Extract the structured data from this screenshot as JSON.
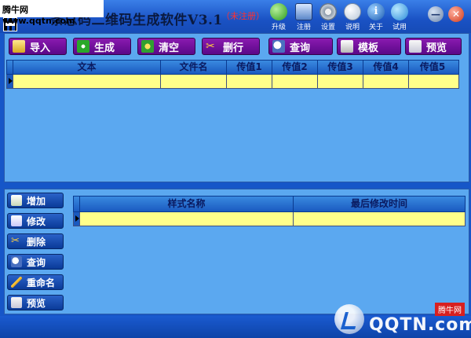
{
  "watermark": {
    "top_left": "腾牛网 www.qqtn.com",
    "brand": "QQTN.com",
    "brand_small": "腾牛网"
  },
  "app": {
    "title": "条总码二维码生成软件V3.1",
    "register_status": "（未注册）"
  },
  "title_toolbar": [
    {
      "label": "升级",
      "icon": "upgrade-icon"
    },
    {
      "label": "注册",
      "icon": "register-icon"
    },
    {
      "label": "设置",
      "icon": "settings-icon"
    },
    {
      "label": "说明",
      "icon": "help-disc-icon"
    },
    {
      "label": "关于",
      "icon": "info-icon"
    },
    {
      "label": "试用",
      "icon": "globe-icon"
    }
  ],
  "window_controls": {
    "minimize": "minimize-icon",
    "close": "close-icon"
  },
  "toolbar": {
    "import": "导入",
    "generate": "生成",
    "clear": "清空",
    "delete_row": "删行",
    "query": "查询",
    "template": "模板",
    "preview": "预览"
  },
  "data_grid": {
    "columns": [
      "文本",
      "文件名",
      "传值1",
      "传值2",
      "传值3",
      "传值4",
      "传值5"
    ],
    "rows": [
      [
        "",
        "",
        "",
        "",
        "",
        "",
        ""
      ]
    ]
  },
  "side_buttons": {
    "add": "增加",
    "edit": "修改",
    "delete": "删除",
    "query": "查询",
    "rename": "重命名",
    "preview": "预览"
  },
  "style_grid": {
    "columns": [
      "样式名称",
      "最后修改时间"
    ],
    "rows": [
      [
        "",
        ""
      ]
    ]
  },
  "colors": {
    "title_bar": "#1a52c4",
    "panel_bg": "#5ba8f0",
    "row_highlight": "#ffff8a",
    "toolbar_button": "#6a0c98",
    "side_button": "#1a4ab0",
    "unregistered": "#ff3030"
  }
}
